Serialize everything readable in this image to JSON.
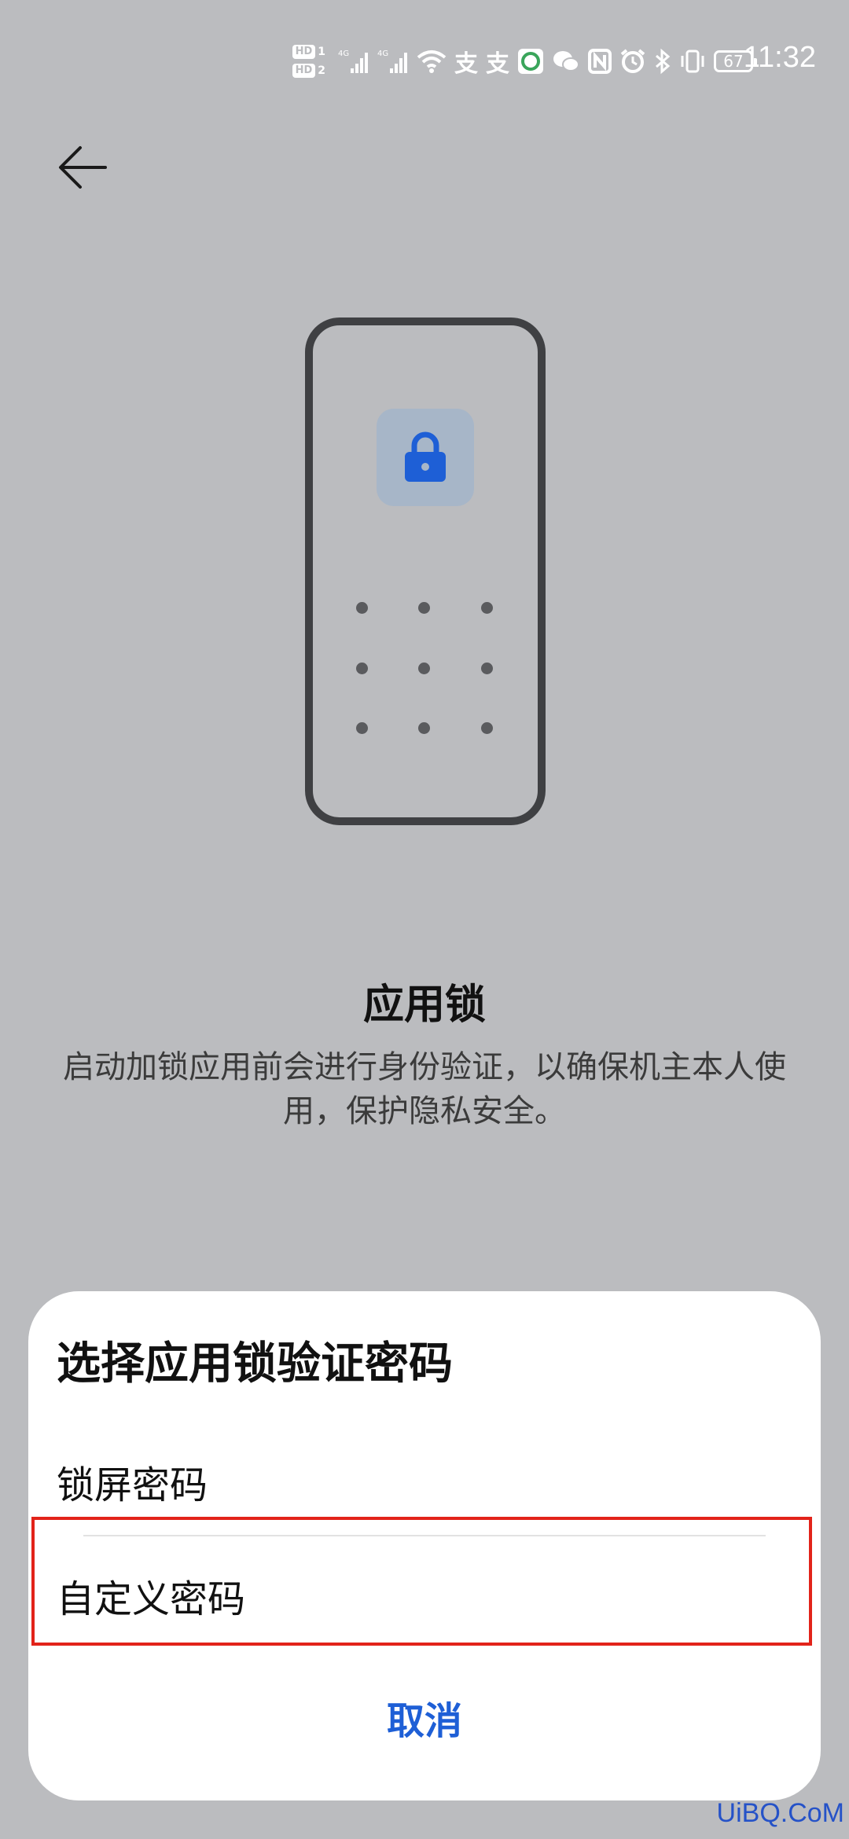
{
  "status_bar": {
    "sim1": "HD",
    "sim1_num": "1",
    "sim2": "HD",
    "sim2_num": "2",
    "net1": "4G",
    "net2": "4G",
    "battery": "67",
    "time": "11:32",
    "icons": [
      "signal-icon",
      "signal-icon",
      "wifi-icon",
      "alipay-icon",
      "alipay-icon",
      "app-notification-icon",
      "wechat-icon",
      "nfc-icon",
      "alarm-icon",
      "bluetooth-icon",
      "vibrate-icon",
      "battery-icon"
    ]
  },
  "header": {
    "back_icon": "back-arrow-icon"
  },
  "illustration": {
    "accent": "#1e5fd6",
    "lock_icon": "lock-icon"
  },
  "intro": {
    "title": "应用锁",
    "description": "启动加锁应用前会进行身份验证，以确保机主本人使用，保护隐私安全。"
  },
  "sheet": {
    "title": "选择应用锁验证密码",
    "options": [
      {
        "label": "锁屏密码"
      },
      {
        "label": "自定义密码"
      }
    ],
    "cancel_label": "取消",
    "highlight_color": "#e2231a"
  },
  "watermark": "UiBQ.CoM"
}
